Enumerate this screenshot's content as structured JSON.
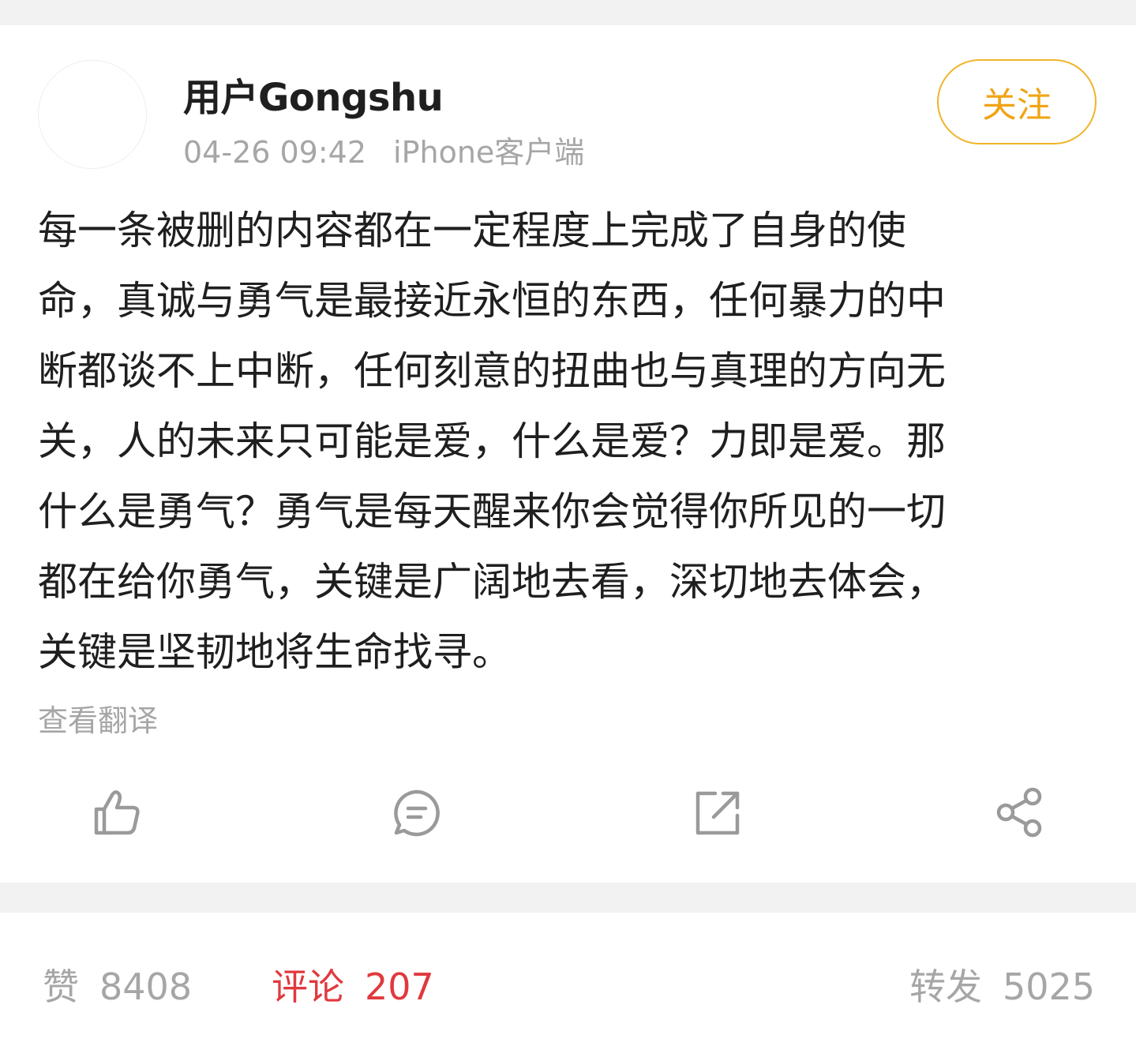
{
  "post": {
    "author": "用户Gongshu",
    "time": "04-26 09:42",
    "source": "iPhone客户端",
    "follow_label": "关注",
    "text_lines": [
      "每一条被删的内容都在一定程度上完成了自身的使",
      "命，真诚与勇气是最接近永恒的东西，任何暴力的中",
      "断都谈不上中断，任何刻意的扭曲也与真理的方向无",
      "关，人的未来只可能是爱，什么是爱？力即是爱。那",
      "什么是勇气？勇气是每天醒来你会觉得你所见的一切",
      "都在给你勇气，关键是广阔地去看，深切地去体会，",
      "关键是坚韧地将生命找寻。"
    ],
    "translate_label": "查看翻译"
  },
  "actions": [
    {
      "name": "like",
      "icon": "thumbs-up-icon"
    },
    {
      "name": "comment",
      "icon": "comment-bubble-icon"
    },
    {
      "name": "repost",
      "icon": "repost-arrow-icon"
    },
    {
      "name": "share",
      "icon": "share-nodes-icon"
    }
  ],
  "stats": {
    "likes_label": "赞",
    "likes_count": "8408",
    "comments_label": "评论",
    "comments_count": "207",
    "reposts_label": "转发",
    "reposts_count": "5025"
  },
  "colors": {
    "follow_accent": "#f0a416",
    "comment_active": "#e0393e",
    "muted_text": "#a6a6a6",
    "icon_gray": "#9a9a9a",
    "band_gray": "#f2f2f2"
  }
}
